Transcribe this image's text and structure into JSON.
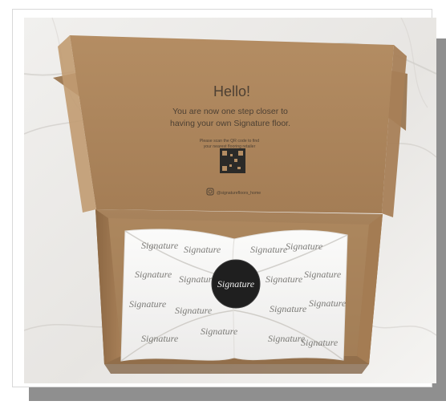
{
  "image": {
    "title": "Hello!",
    "line1": "You are now one step closer to",
    "line2": "having your own Signature floor.",
    "small_line1": "Please scan the QR code to find",
    "small_line2": "your nearest flooring retailer",
    "handle": "@signaturefloors_home",
    "sticker_text": "Signature",
    "paper_text": "Signature"
  },
  "colors": {
    "marble": "#ece9e6",
    "kraft": "#b08b62",
    "kraft_dark": "#8c6a44",
    "sticker": "#1f1f1f",
    "tissue": "#f7f7f6",
    "shadow": "#8f8f8f"
  }
}
